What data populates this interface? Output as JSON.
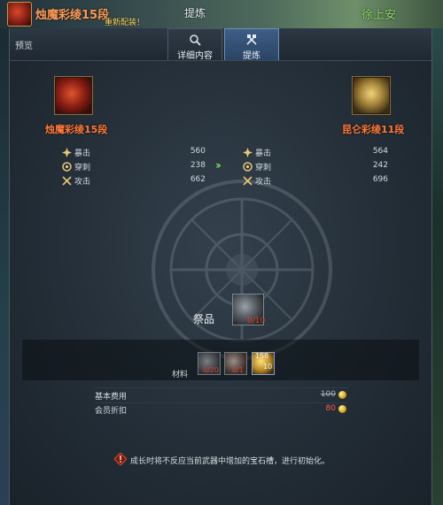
{
  "hud": {
    "item_title": "烛魔彩绫15段",
    "sub_text": "重新配装！",
    "refine_title": "提炼",
    "right_title": "徐上安"
  },
  "window": {
    "preview_label": "预览",
    "tabs": [
      {
        "label": "详细内容",
        "icon": "search-icon",
        "active": false
      },
      {
        "label": "提炼",
        "icon": "tools-icon",
        "active": true
      }
    ]
  },
  "source_item": {
    "name": "烛魔彩绫15段",
    "stats": [
      {
        "label": "暴击",
        "value": "560",
        "icon": "crit-icon"
      },
      {
        "label": "穿刺",
        "value": "238",
        "icon": "pierce-icon"
      },
      {
        "label": "攻击",
        "value": "662",
        "icon": "attack-icon"
      }
    ]
  },
  "target_item": {
    "name": "昆仑彩绫11段",
    "stats": [
      {
        "label": "暴击",
        "value": "564",
        "icon": "crit-icon"
      },
      {
        "label": "穿刺",
        "value": "242",
        "icon": "pierce-icon"
      },
      {
        "label": "攻击",
        "value": "696",
        "icon": "attack-icon"
      }
    ]
  },
  "arrow_glyph": "››",
  "offering": {
    "label": "祭品",
    "count": "0/10"
  },
  "materials": {
    "label": "材料",
    "items": [
      {
        "count": "0/20"
      },
      {
        "count": "0/1"
      },
      {
        "count_top": "158",
        "count_bottom": "10"
      }
    ]
  },
  "cost": {
    "base_label": "基本费用",
    "base_value": "100",
    "member_label": "会员折扣",
    "member_value": "80"
  },
  "notice": {
    "text": "成长时将不反应当前武器中增加的宝石槽，进行初始化。"
  },
  "colors": {
    "item_name": "#ff7a3a",
    "arrow": "#6fd24a",
    "deficit": "#e23c2c",
    "active_tab": "#3e5e86"
  }
}
